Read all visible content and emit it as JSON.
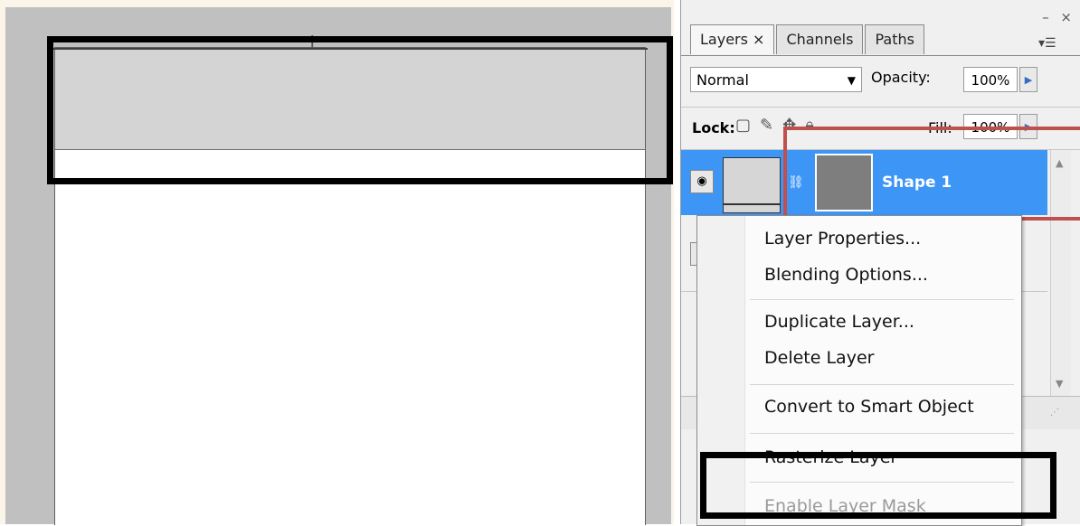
{
  "panel": {
    "window_controls": "– ×",
    "tabs": [
      {
        "label": "Layers ×"
      },
      {
        "label": "Channels"
      },
      {
        "label": "Paths"
      }
    ],
    "panel_menu_icon": "▾☰",
    "blend_mode": "Normal",
    "opacity_label": "Opacity:",
    "opacity_value": "100%",
    "lock_label": "Lock:",
    "fill_label": "Fill:",
    "fill_value": "100%",
    "layer": {
      "name": "Shape 1"
    }
  },
  "context_menu": {
    "items": [
      {
        "label": "Layer Properties..."
      },
      {
        "label": "Blending Options..."
      },
      {
        "label": "Duplicate Layer..."
      },
      {
        "label": "Delete Layer"
      },
      {
        "label": "Convert to Smart Object"
      },
      {
        "label": "Rasterize Layer"
      },
      {
        "label": "Enable Layer Mask"
      }
    ]
  },
  "colors": {
    "selection_blue": "#3d95f5",
    "guide_red": "#c0504d",
    "highlight_black": "#000000"
  }
}
